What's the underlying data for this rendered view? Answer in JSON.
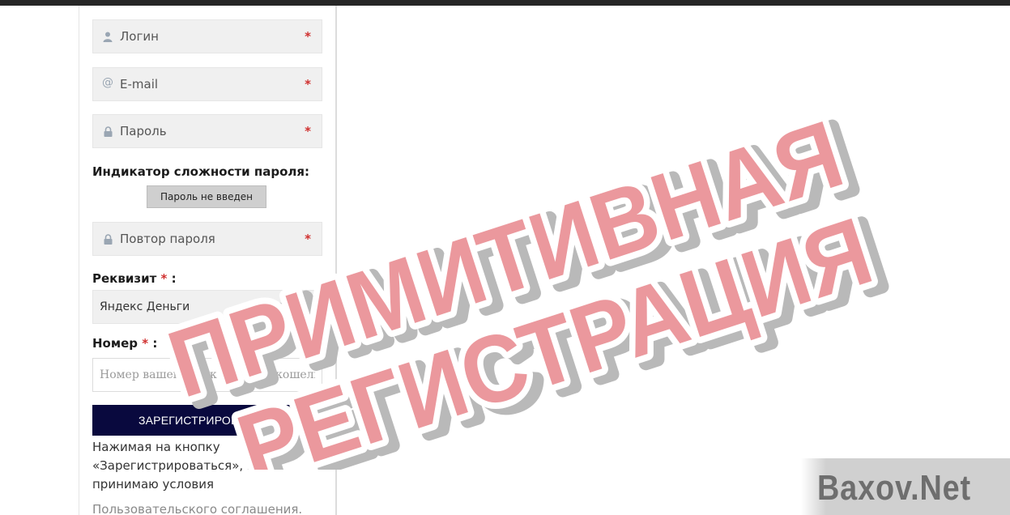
{
  "form": {
    "login": {
      "placeholder": "Логин",
      "required_mark": "*"
    },
    "email": {
      "placeholder": "E-mail",
      "required_mark": "*"
    },
    "password": {
      "placeholder": "Пароль",
      "required_mark": "*"
    },
    "strength_label": "Индикатор сложности пароля:",
    "strength_value": "Пароль не введен",
    "password_repeat": {
      "placeholder": "Повтор пароля",
      "required_mark": "*"
    },
    "requisite_label": "Реквизит",
    "requisite_req": "*",
    "requisite_colon": ":",
    "requisite_value": "Яндекс Деньги",
    "number_label": "Номер",
    "number_req": "*",
    "number_colon": ":",
    "number_placeholder": "Номер вашего электронного кошелька",
    "register_button": "ЗАРЕГИСТРИРОВАТЬСЯ",
    "terms_text": "Нажимая на кнопку «Зарегистрироваться», я принимаю условия",
    "terms_link": "Пользовательского соглашения."
  },
  "overlay": {
    "stamp_line1": "ПРИМИТИВНАЯ",
    "stamp_line2": "РЕГИСТРАЦИЯ"
  },
  "watermark": {
    "text": "Baxov.Net"
  },
  "colors": {
    "top_bar": "#262626",
    "required": "#d0302f",
    "button_bg": "#09093e",
    "stamp_fill": "#e88a8f",
    "stamp_outline": "#ffffff"
  },
  "icons": {
    "login": "user-icon",
    "email": "at-icon",
    "password": "lock-icon",
    "password_repeat": "lock-icon"
  }
}
